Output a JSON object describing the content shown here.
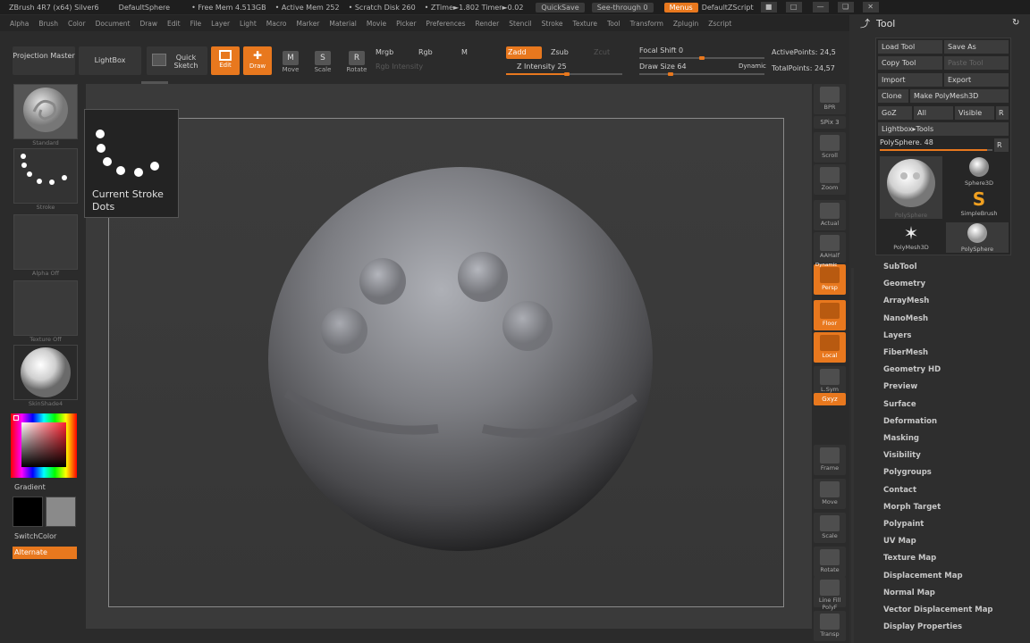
{
  "titlebar": {
    "app": "ZBrush 4R7 (x64) Silver6",
    "doc": "DefaultSphere",
    "free_mem": "• Free Mem 4.513GB",
    "active_mem": "• Active Mem 252",
    "scratch": "• Scratch Disk 260",
    "ztime": "• ZTime►1.802 Timer►0.02",
    "quicksave": "QuickSave",
    "see_through": "See-through  0",
    "menus": "Menus",
    "script": "DefaultZScript"
  },
  "menubar": [
    "Alpha",
    "Brush",
    "Color",
    "Document",
    "Draw",
    "Edit",
    "File",
    "Layer",
    "Light",
    "Macro",
    "Marker",
    "Material",
    "Movie",
    "Picker",
    "Preferences",
    "Render",
    "Stencil",
    "Stroke",
    "Texture",
    "Tool",
    "Transform",
    "Zplugin",
    "Zscript"
  ],
  "toolbar": {
    "projection_master": "Projection Master",
    "lightbox": "LightBox",
    "quick_sketch": "Quick Sketch",
    "edit": "Edit",
    "draw": "Draw",
    "move": "Move",
    "scale": "Scale",
    "rotate": "Rotate",
    "mrgb": "Mrgb",
    "rgb": "Rgb",
    "m": "M",
    "rgb_intensity": "Rgb Intensity",
    "zadd": "Zadd",
    "zsub": "Zsub",
    "zcut": "Zcut",
    "z_intensity": "Z Intensity 25",
    "focal_shift": "Focal Shift 0",
    "draw_size": "Draw Size 64",
    "dynamic": "Dynamic",
    "active_points": "ActivePoints: 24,5",
    "total_points": "TotalPoints: 24,57",
    "z_intensity_level": 0.25,
    "focal_shift_level": 0.5,
    "draw_size_level": 0.25
  },
  "left_shelf": {
    "standard": "Standard",
    "stroke": "Stroke",
    "alpha_off": "Alpha Off",
    "texture_off": "Texture Off",
    "material": "SkinShade4",
    "gradient": "Gradient",
    "switch_color": "SwitchColor",
    "alternate": "Alternate"
  },
  "stroke_popup": {
    "line1": "Current Stroke",
    "line2": "Dots"
  },
  "right_shelf": [
    "BPR",
    "SPix 3",
    "Scroll",
    "Zoom",
    "Actual",
    "AAHalf",
    "Persp",
    "Floor",
    "Local",
    "L.Sym",
    "Gxyz",
    "Frame",
    "Move",
    "Scale",
    "Rotate",
    "Line Fill PolyF",
    "Transp"
  ],
  "right_shelf_dynamic": "Dynamic",
  "tool_panel": {
    "title": "Tool",
    "load_tool": "Load Tool",
    "save_as": "Save As",
    "copy_tool": "Copy Tool",
    "paste_tool": "Paste Tool",
    "import": "Import",
    "export": "Export",
    "clone": "Clone",
    "make_polymesh": "Make PolyMesh3D",
    "goz": "GoZ",
    "all": "All",
    "visible": "Visible",
    "r": "R",
    "lightbox_tools": "Lightbox▸Tools",
    "current_tool": "PolySphere. 48",
    "current_tool_level": 0.95,
    "thumbs": {
      "polysphere_big": "PolySphere",
      "sphere3d": "Sphere3D",
      "simplebrush": "SimpleBrush",
      "polymesh3d": "PolyMesh3D",
      "polysphere_small": "PolySphere"
    },
    "sections": [
      "SubTool",
      "Geometry",
      "ArrayMesh",
      "NanoMesh",
      "Layers",
      "FiberMesh",
      "Geometry HD",
      "Preview",
      "Surface",
      "Deformation",
      "Masking",
      "Visibility",
      "Polygroups",
      "Contact",
      "Morph Target",
      "Polypaint",
      "UV Map",
      "Texture Map",
      "Displacement Map",
      "Normal Map",
      "Vector Displacement Map",
      "Display Properties"
    ]
  },
  "colors": {
    "accent": "#e8781e",
    "background": "#2b2b2b",
    "canvas": "#3a3a3a"
  }
}
